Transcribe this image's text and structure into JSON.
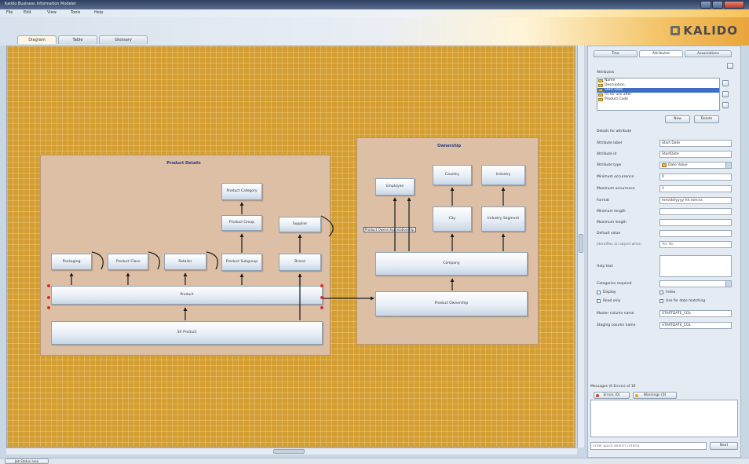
{
  "window": {
    "title": "Kalido Business Information Modeler"
  },
  "menu": [
    "File",
    "Edit",
    "View",
    "Tools",
    "Help"
  ],
  "brand": {
    "logo_text": "KALIDO"
  },
  "tabs": [
    "Diagram",
    "Table",
    "Glossary"
  ],
  "diagram": {
    "groups": {
      "product": "Product Details",
      "ownership": "Ownership"
    },
    "entities": {
      "product_category": "Product Category",
      "product_group": "Product Group",
      "supplier": "Supplier",
      "packaging": "Packaging",
      "product_class": "Product Class",
      "retailer": "Retailer",
      "product_subgroup": "Product Subgroup",
      "brand": "Brand",
      "product": "Product",
      "sku": "SV Product",
      "employee": "Employee",
      "country": "Country",
      "industry": "Industry",
      "city": "City",
      "industry_segment": "Industry Segment",
      "company": "Company",
      "product_ownership": "Product Ownership"
    },
    "tooltip": "Product Ownership relationship"
  },
  "panel": {
    "tabs": [
      "Tree",
      "Attributes",
      "Associations"
    ],
    "attributes_label": "Attributes",
    "attribute_list": [
      "Name",
      "Description",
      "Start Date",
      "Fit for use after",
      "Product Code"
    ],
    "selected_index": 2,
    "new_button": "New",
    "delete_button": "Delete",
    "details_header": "Details for attribute",
    "fields": [
      {
        "label": "Attribute label",
        "value": "Start Date"
      },
      {
        "label": "Attribute id",
        "value": "StartDate"
      },
      {
        "label": "Attribute type",
        "value": "Date Value"
      },
      {
        "label": "Minimum occurrence",
        "value": "0"
      },
      {
        "label": "Maximum occurrence",
        "value": "1"
      },
      {
        "label": "Format",
        "value": "mm/dd/yyyy hh:mm:ss"
      },
      {
        "label": "Minimum length",
        "value": ""
      },
      {
        "label": "Maximum length",
        "value": ""
      },
      {
        "label": "Default value",
        "value": ""
      }
    ],
    "identifies_label": "Identifies an object when",
    "yes_no": "Yes  No",
    "help_text_label": "Help text",
    "categories_label": "Categories required",
    "checks": {
      "display": "Display",
      "read_only": "Read only",
      "index": "Index",
      "date_matching": "Use for date matching"
    },
    "master_column_label": "Master column name",
    "master_column_value": "STARTDATE_COL",
    "staging_column_label": "Staging column name",
    "staging_column_value": "STARTDATE_COL",
    "messages_header": "Messages (0 Errors) of 19",
    "errors_tab": "Errors (0)",
    "warnings_tab": "Warnings (0)",
    "search_placeholder": "Enter quick search criteria",
    "search_button": "Next"
  },
  "status": {
    "tab": "Job Status area"
  },
  "colors": {
    "canvas": "#d49e33",
    "group_fill": "#dcbfa4",
    "selection": "#3c6fc4"
  }
}
